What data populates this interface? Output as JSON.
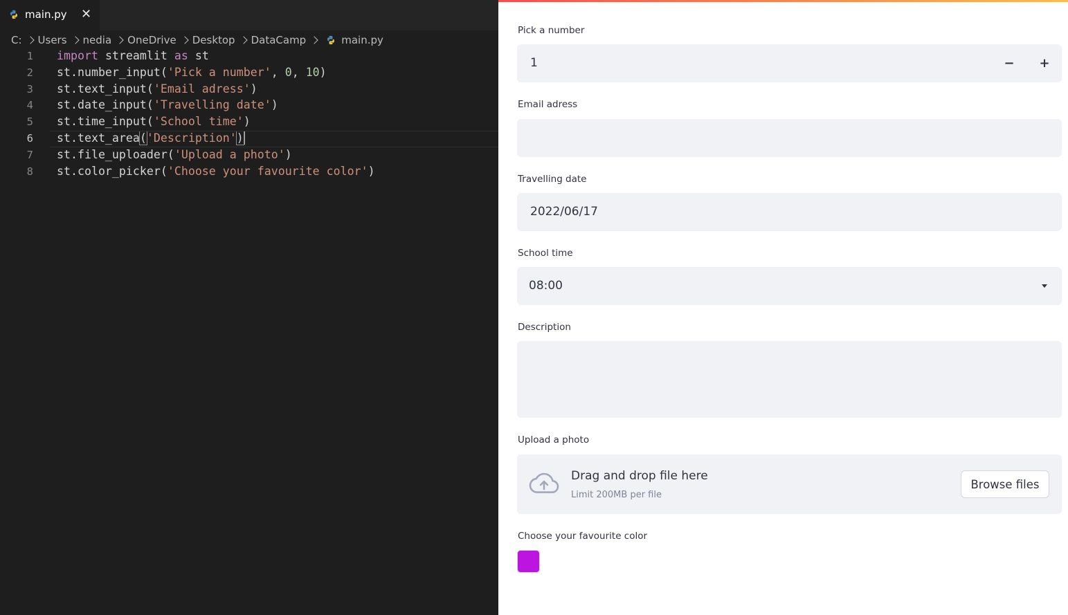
{
  "editor": {
    "tab": {
      "label": "main.py",
      "close_glyph": "✕",
      "icon": "python-file-icon"
    },
    "breadcrumb": [
      "C:",
      "Users",
      "nedia",
      "OneDrive",
      "Desktop",
      "DataCamp",
      "main.py"
    ],
    "current_line": 6,
    "lines": [
      {
        "n": "1",
        "parts": [
          [
            "kw",
            "import"
          ],
          [
            "pl",
            " streamlit "
          ],
          [
            "kw",
            "as"
          ],
          [
            "pl",
            " st"
          ]
        ]
      },
      {
        "n": "2",
        "parts": [
          [
            "pl",
            "st.number_input("
          ],
          [
            "str",
            "'Pick a number'"
          ],
          [
            "pl",
            ", "
          ],
          [
            "num",
            "0"
          ],
          [
            "pl",
            ", "
          ],
          [
            "num",
            "10"
          ],
          [
            "pl",
            ")"
          ]
        ]
      },
      {
        "n": "3",
        "parts": [
          [
            "pl",
            "st.text_input("
          ],
          [
            "str",
            "'Email adress'"
          ],
          [
            "pl",
            ")"
          ]
        ]
      },
      {
        "n": "4",
        "parts": [
          [
            "pl",
            "st.date_input("
          ],
          [
            "str",
            "'Travelling date'"
          ],
          [
            "pl",
            ")"
          ]
        ]
      },
      {
        "n": "5",
        "parts": [
          [
            "pl",
            "st.time_input("
          ],
          [
            "str",
            "'School time'"
          ],
          [
            "pl",
            ")"
          ]
        ]
      },
      {
        "n": "6",
        "parts": [
          [
            "pl",
            "st.text_area"
          ],
          [
            "br",
            "("
          ],
          [
            "str",
            "'Description'"
          ],
          [
            "br",
            ")"
          ],
          [
            "caret",
            ""
          ]
        ]
      },
      {
        "n": "7",
        "parts": [
          [
            "pl",
            "st.file_uploader("
          ],
          [
            "str",
            "'Upload a photo'"
          ],
          [
            "pl",
            ")"
          ]
        ]
      },
      {
        "n": "8",
        "parts": [
          [
            "pl",
            "st.color_picker("
          ],
          [
            "str",
            "'Choose your favourite color'"
          ],
          [
            "pl",
            ")"
          ]
        ]
      }
    ]
  },
  "app": {
    "number": {
      "label": "Pick a number",
      "value": "1",
      "minus": "−",
      "plus": "+"
    },
    "email": {
      "label": "Email adress",
      "value": ""
    },
    "date": {
      "label": "Travelling date",
      "value": "2022/06/17"
    },
    "time": {
      "label": "School time",
      "value": "08:00"
    },
    "description": {
      "label": "Description",
      "value": ""
    },
    "upload": {
      "label": "Upload a photo",
      "title": "Drag and drop file here",
      "subtitle": "Limit 200MB per file",
      "button": "Browse files",
      "icon": "cloud-upload-icon"
    },
    "color": {
      "label": "Choose your favourite color",
      "value": "#BD14E2"
    }
  },
  "colors": {
    "accent_start": "#ff4b4b",
    "accent_end": "#ffbd45",
    "field_bg": "#f0f2f6",
    "editor_bg": "#1e1e1e"
  }
}
